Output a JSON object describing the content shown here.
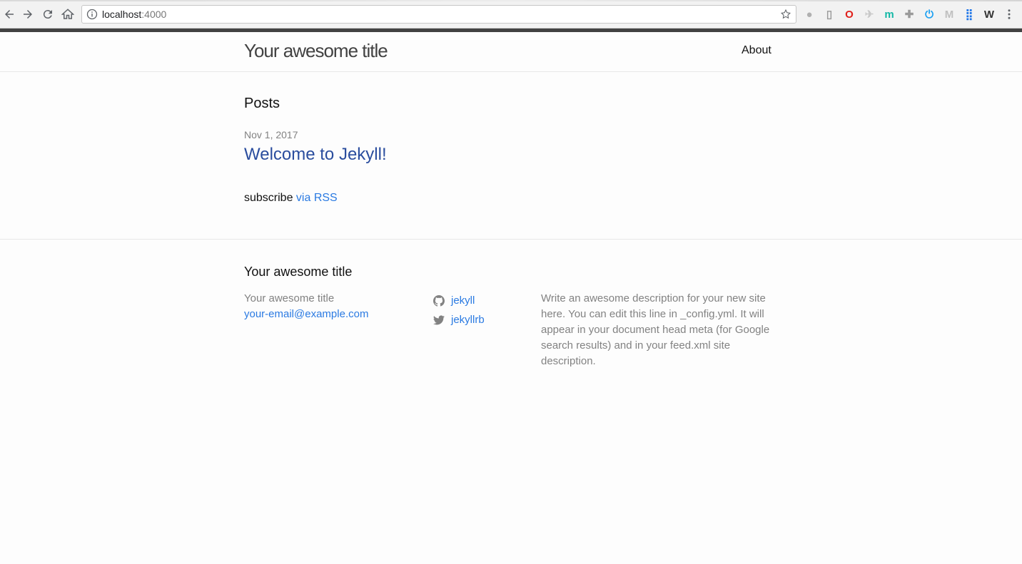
{
  "browser": {
    "url_host": "localhost",
    "url_port": ":4000",
    "icons": [
      "back-icon",
      "forward-icon",
      "reload-icon",
      "home-icon",
      "info-icon",
      "bookmark-star-icon",
      "menu-dots-icon"
    ],
    "extensions": [
      {
        "name": "ext-gray-circle-icon",
        "glyph": "●",
        "color": "#b0b0b0"
      },
      {
        "name": "ext-document-icon",
        "glyph": "▯",
        "color": "#9a9a9a"
      },
      {
        "name": "ext-opera-icon",
        "glyph": "O",
        "color": "#e0201b"
      },
      {
        "name": "ext-plane-icon",
        "glyph": "✈",
        "color": "#c9c9c9"
      },
      {
        "name": "ext-m-teal-icon",
        "glyph": "m",
        "color": "#14b8a6"
      },
      {
        "name": "ext-puzzle-icon",
        "glyph": "✚",
        "color": "#9a9a9a"
      },
      {
        "name": "ext-power-icon",
        "glyph": "⏻",
        "color": "#1da1f2"
      },
      {
        "name": "ext-m-gray-icon",
        "glyph": "M",
        "color": "#c0c0c0"
      },
      {
        "name": "ext-apps-grid-icon",
        "glyph": "⣿",
        "color": "#1a73e8"
      },
      {
        "name": "ext-w-icon",
        "glyph": "W",
        "color": "#333333"
      }
    ]
  },
  "header": {
    "site_title": "Your awesome title",
    "nav_about": "About"
  },
  "main": {
    "posts_heading": "Posts",
    "post": {
      "date": "Nov 1, 2017",
      "title": "Welcome to Jekyll!"
    },
    "rss_prefix": "subscribe ",
    "rss_link": "via RSS"
  },
  "footer": {
    "heading": "Your awesome title",
    "site_name": "Your awesome title",
    "email": "your-email@example.com",
    "github_user": "jekyll",
    "twitter_user": "jekyllrb",
    "description": "Write an awesome description for your new site here. You can edit this line in _config.yml. It will appear in your document head meta (for Google search results) and in your feed.xml site description."
  },
  "colors": {
    "link": "#2a7ae2",
    "post_link": "#2a4d9e",
    "muted": "#828282"
  }
}
